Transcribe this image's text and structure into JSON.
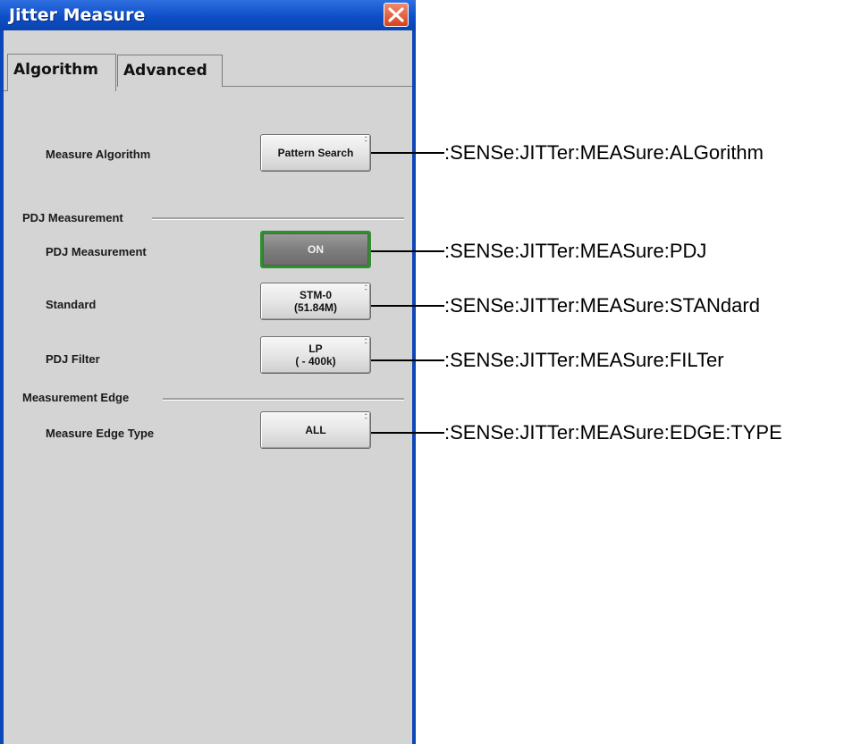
{
  "window": {
    "title": "Jitter Measure"
  },
  "tabs": [
    {
      "label": "Algorithm",
      "active": true
    },
    {
      "label": "Advanced",
      "active": false
    }
  ],
  "settings": {
    "algorithm": {
      "label": "Measure Algorithm",
      "value": "Pattern Search"
    },
    "pdj_group": "PDJ Measurement",
    "pdj_measurement": {
      "label": "PDJ Measurement",
      "value": "ON"
    },
    "standard": {
      "label": "Standard",
      "value_line1": "STM-0",
      "value_line2": "(51.84M)"
    },
    "pdj_filter": {
      "label": "PDJ Filter",
      "value_line1": "LP",
      "value_line2": "( - 400k)"
    },
    "edge_group": "Measurement Edge",
    "edge_type": {
      "label": "Measure Edge Type",
      "value": "ALL"
    }
  },
  "commands": {
    "algorithm": ":SENSe:JITTer:MEASure:ALGorithm",
    "pdj": ":SENSe:JITTer:MEASure:PDJ",
    "standard": ":SENSe:JITTer:MEASure:STANdard",
    "filter": ":SENSe:JITTer:MEASure:FILTer",
    "edge_type": ":SENSe:JITTer:MEASure:EDGE:TYPE"
  },
  "colors": {
    "titlebar": "#0d4fc8",
    "panel": "#d4d4d4",
    "active_border": "#2f8f2f"
  }
}
